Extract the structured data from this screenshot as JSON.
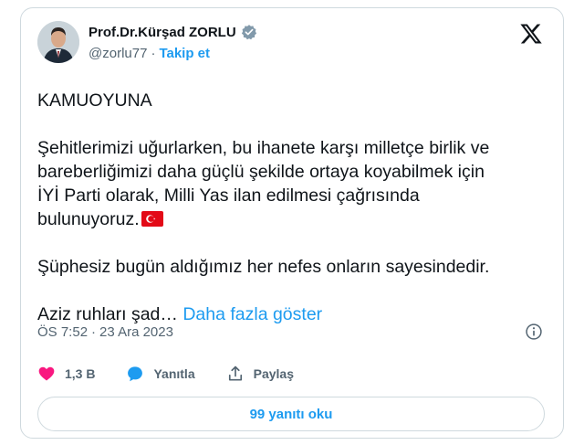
{
  "author": {
    "display_name": "Prof.Dr.Kürşad ZORLU",
    "handle": "@zorlu77",
    "separator": "·",
    "follow_label": "Takip et",
    "verified_color": "#829aab"
  },
  "tweet": {
    "lines": [
      "KAMUOYUNA",
      "Şehitlerimizi uğurlarken, bu ihanete karşı milletçe birlik ve",
      "bareberliğimizi daha güçlü şekilde ortaya koyabilmek için",
      "İYİ Parti olarak, Milli Yas ilan edilmesi çağrısında",
      "bulunuyoruz.",
      "Şüphesiz bugün aldığımız her nefes onların sayesindedir.",
      "Aziz ruhları şad…"
    ],
    "show_more_label": "Daha fazla göster",
    "flag_icon": "turkey-flag-icon"
  },
  "meta": {
    "time": "ÖS 7:52",
    "separator": "·",
    "date": "23 Ara 2023"
  },
  "actions": {
    "likes_count": "1,3 B",
    "reply_label": "Yanıtla",
    "share_label": "Paylaş",
    "like_icon": "heart-icon",
    "reply_icon": "speech-bubble-icon",
    "share_icon": "share-icon"
  },
  "read_replies_label": "99 yanıtı oku",
  "colors": {
    "accent": "#1d9bf0",
    "like": "#f91880",
    "text": "#0f1419",
    "secondary": "#536471",
    "border": "#cfd9de"
  }
}
